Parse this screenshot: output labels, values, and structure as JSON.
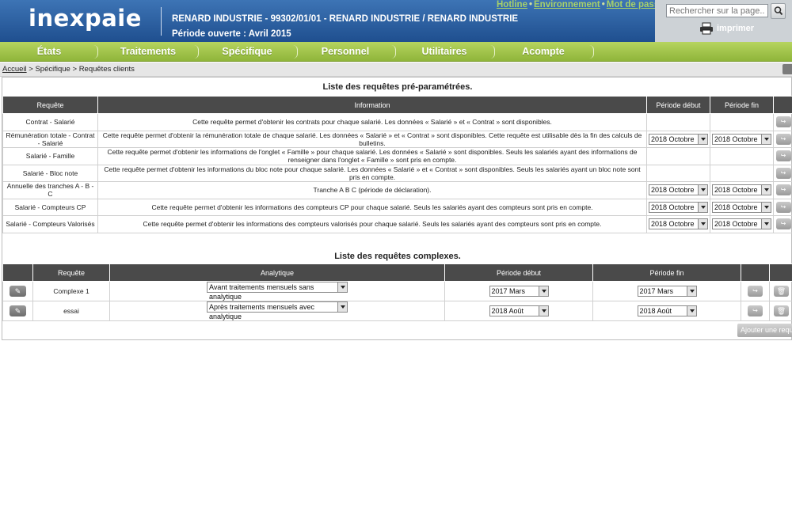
{
  "header": {
    "logo": "inexpaie",
    "company": "RENARD INDUSTRIE - 99302/01/01 - RENARD INDUSTRIE / RENARD INDUSTRIE",
    "period": "Période ouverte : Avril 2015",
    "links": [
      "Hotline",
      "Environnement",
      "Mot de passe"
    ],
    "link_separator": "•",
    "search_placeholder": "Rechercher sur la page...",
    "print_label": "imprimer"
  },
  "menu": [
    "États",
    "Traitements",
    "Spécifique",
    "Personnel",
    "Utilitaires",
    "Acompte"
  ],
  "breadcrumb": {
    "home": "Accueil",
    "sep": ">",
    "items": [
      "Spécifique",
      "Requêtes clients"
    ]
  },
  "preset": {
    "title": "Liste des requêtes pré-paramétrées.",
    "headers": [
      "Requête",
      "Information",
      "Période début",
      "Période fin"
    ],
    "rows": [
      {
        "name": "Contrat - Salarié",
        "info": "Cette requête permet d'obtenir les contrats pour chaque salarié. Les données « Salarié » et « Contrat » sont disponibles.",
        "start": "",
        "end": ""
      },
      {
        "name": "Rémunération totale - Contrat - Salarié",
        "info": "Cette requête permet d'obtenir la rémunération totale de chaque salarié. Les données « Salarié » et « Contrat » sont disponibles. Cette requête est utilisable dès la fin des calculs de bulletins.",
        "start": "2018 Octobre",
        "end": "2018 Octobre"
      },
      {
        "name": "Salarié - Famille",
        "info": "Cette requête permet d'obtenir les informations de l'onglet « Famille » pour chaque salarié. Les données « Salarié » sont disponibles. Seuls les salariés ayant des informations de renseigner dans l'onglet « Famille » sont pris en compte.",
        "start": "",
        "end": ""
      },
      {
        "name": "Salarié - Bloc note",
        "info": "Cette requête permet d'obtenir les informations du bloc note pour chaque salarié. Les données « Salarié » et « Contrat » sont disponibles. Seuls les salariés ayant un bloc note sont pris en compte.",
        "start": "",
        "end": ""
      },
      {
        "name": "Annuelle des tranches A - B - C",
        "info": "Tranche A B C (période de déclaration).",
        "start": "2018 Octobre",
        "end": "2018 Octobre"
      },
      {
        "name": "Salarié - Compteurs CP",
        "info": "Cette requête permet d'obtenir les informations des compteurs CP pour chaque salarié. Seuls les salariés ayant des compteurs sont pris en compte.",
        "start": "2018 Octobre",
        "end": "2018 Octobre"
      },
      {
        "name": "Salarié - Compteurs Valorisés",
        "info": "Cette requête permet d'obtenir les informations des compteurs valorisés pour chaque salarié. Seuls les salariés ayant des compteurs sont pris en compte.",
        "start": "2018 Octobre",
        "end": "2018 Octobre"
      }
    ]
  },
  "complex": {
    "title": "Liste des requêtes complexes.",
    "headers": [
      "Requête",
      "Analytique",
      "Période début",
      "Période fin"
    ],
    "rows": [
      {
        "name": "Complexe 1",
        "analytic": "Avant traitements mensuels sans analytique",
        "start": "2017 Mars",
        "end": "2017 Mars"
      },
      {
        "name": "essai",
        "analytic": "Après traitements mensuels avec analytique",
        "start": "2018 Août",
        "end": "2018 Août"
      }
    ],
    "add_label": "Ajouter une requête"
  },
  "colors": {
    "header_blue": "#2b5fa0",
    "menu_green": "#9dc24a",
    "table_header": "#4a4a4a"
  }
}
